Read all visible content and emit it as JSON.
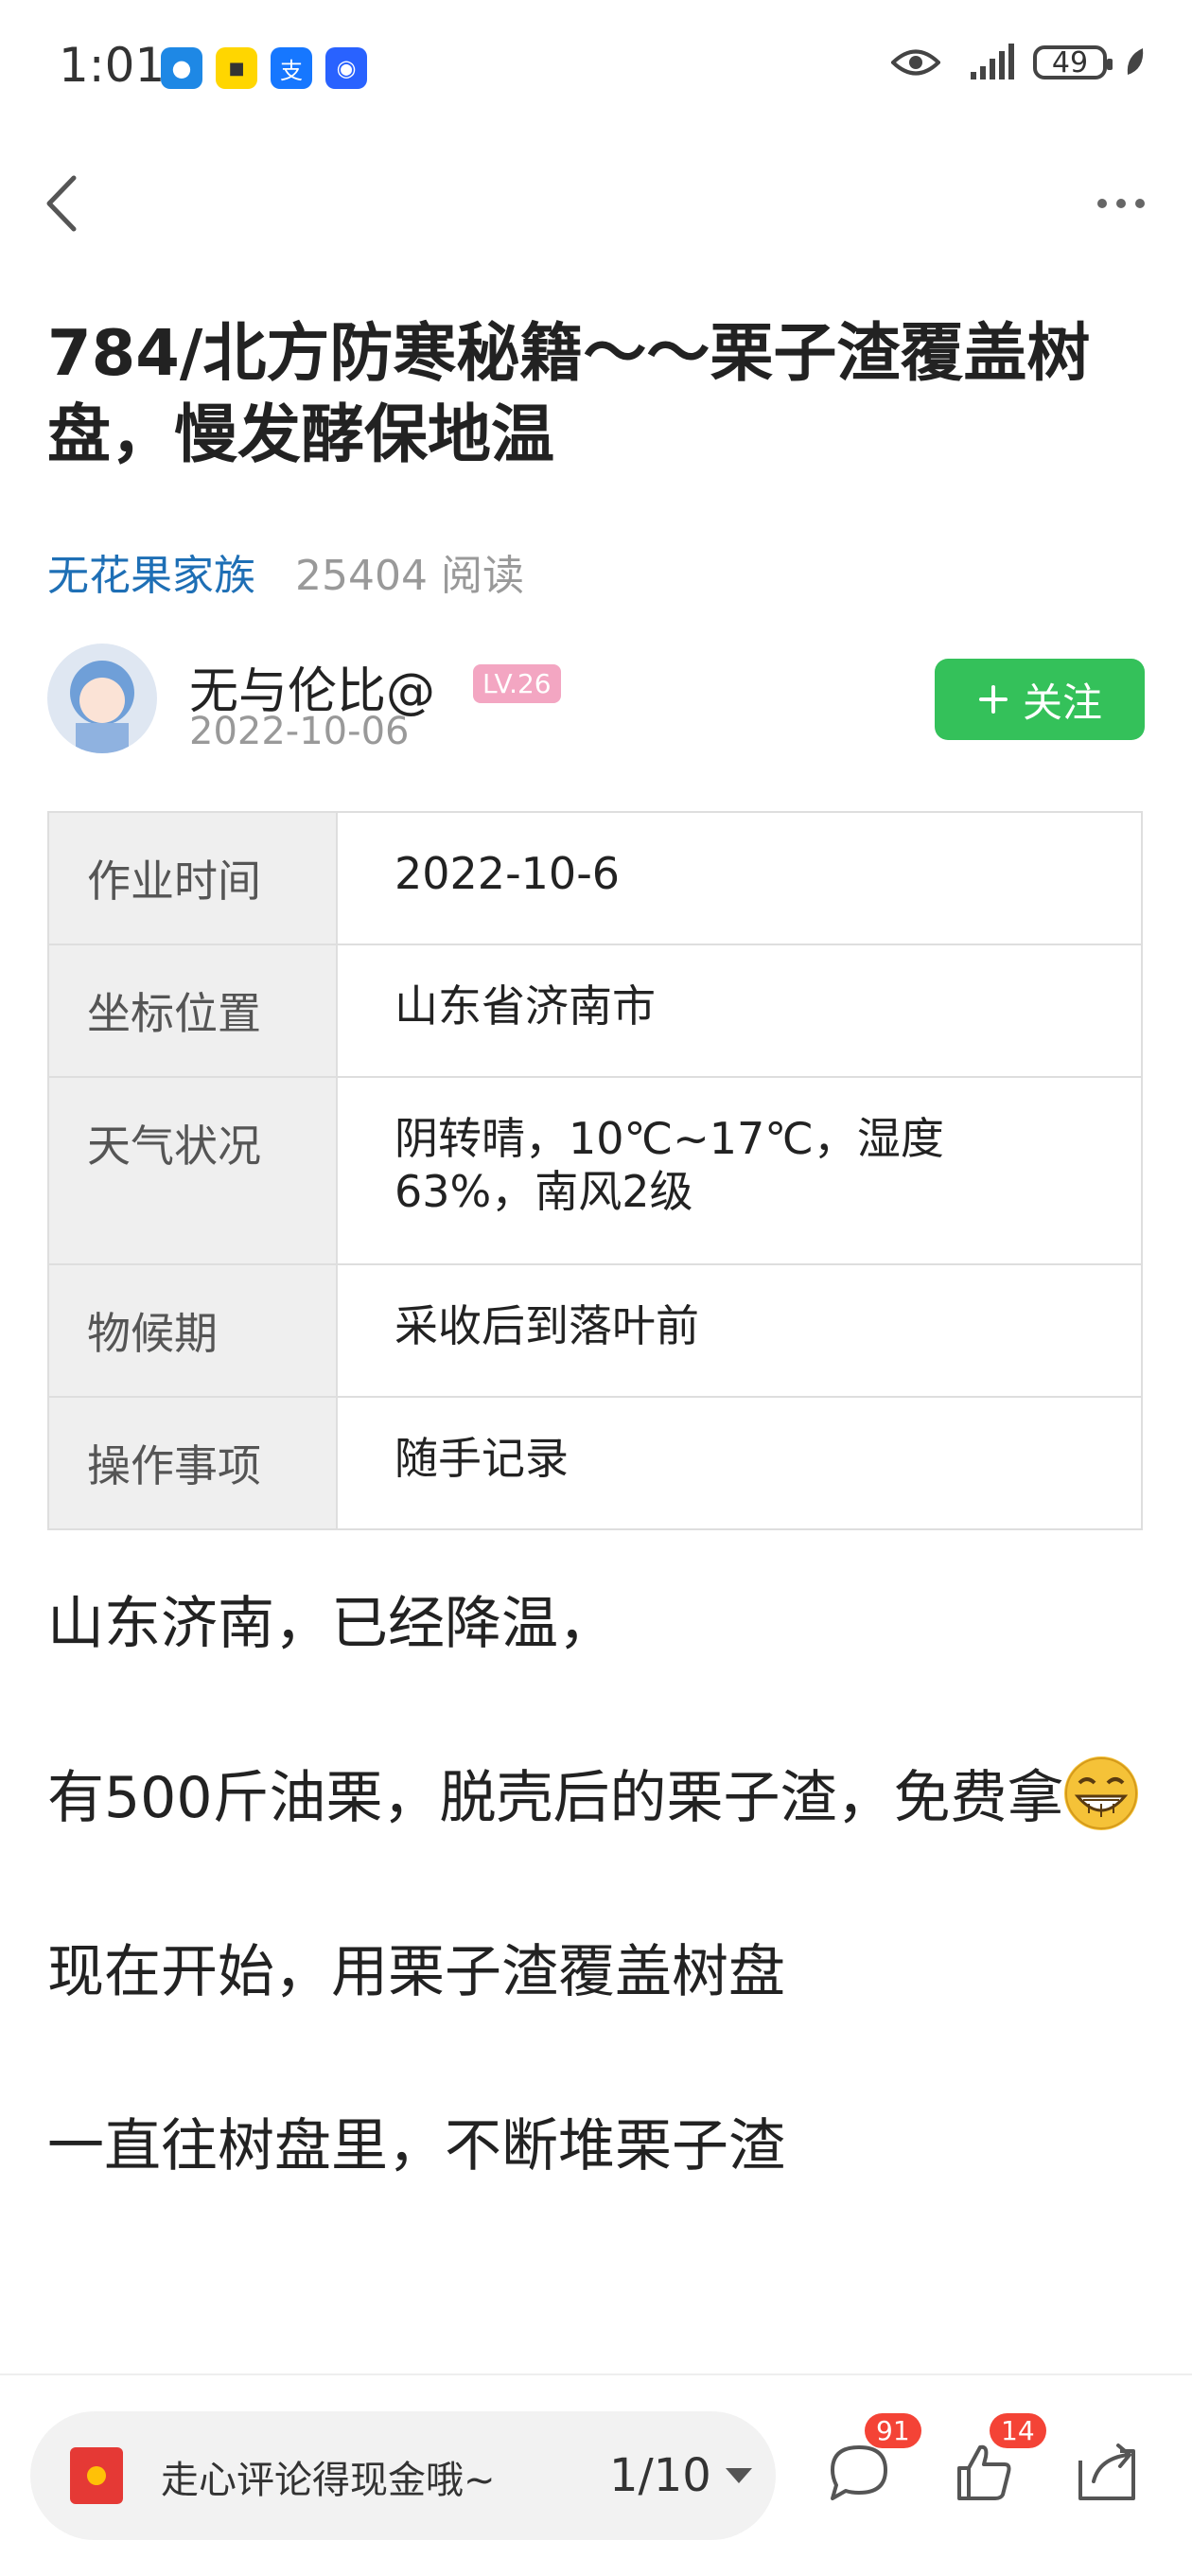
{
  "status_bar": {
    "time": "1:01",
    "battery": "49"
  },
  "article": {
    "title": "784/北方防寒秘籍～～栗子渣覆盖树盘，慢发酵保地温",
    "group": "无花果家族",
    "reads": "25404 阅读",
    "author": {
      "name": "无与伦比@",
      "level": "LV.26",
      "date": "2022-10-06",
      "follow_label": "关注"
    },
    "info_table": [
      {
        "key": "作业时间",
        "value": "2022-10-6"
      },
      {
        "key": "坐标位置",
        "value": "山东省济南市"
      },
      {
        "key": "天气状况",
        "value": "阴转晴，10℃~17℃，湿度63%，南风2级"
      },
      {
        "key": "物候期",
        "value": "采收后到落叶前"
      },
      {
        "key": "操作事项",
        "value": "随手记录"
      }
    ],
    "paragraphs": [
      "山东济南，已经降温，",
      "有500斤油栗，脱壳后的栗子渣，免费拿",
      "现在开始，用栗子渣覆盖树盘",
      "一直往树盘里，不断堆栗子渣"
    ],
    "emoji": "grinning-face"
  },
  "bottom_bar": {
    "comment_prompt": "走心评论得现金哦~",
    "page_indicator": "1/10",
    "comment_count": "91",
    "like_count": "14"
  },
  "colors": {
    "follow_green": "#34c15a",
    "link_blue": "#1e6fb5",
    "badge_red": "#f44336",
    "level_pink": "#f3a6c2"
  }
}
